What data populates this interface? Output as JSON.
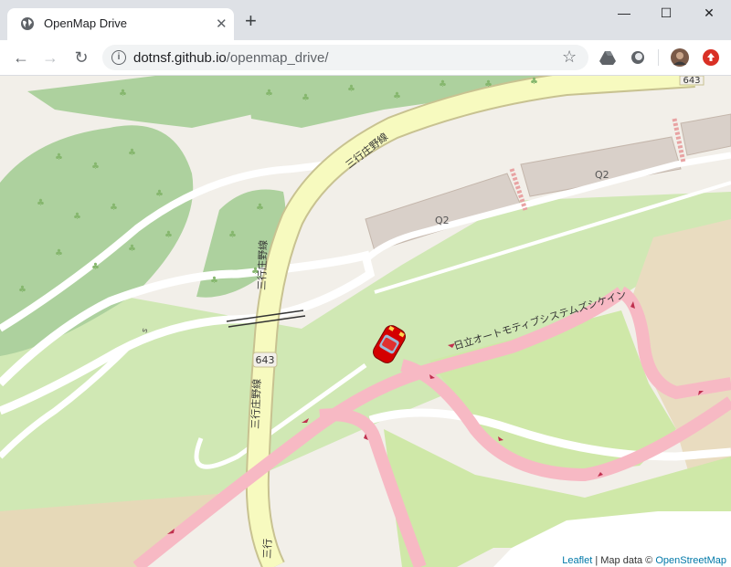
{
  "tab": {
    "title": "OpenMap Drive"
  },
  "window": {
    "minimize": "—",
    "maximize": "☐",
    "close": "✕"
  },
  "address": {
    "host": "dotnsf.github.io",
    "path": "/openmap_drive/"
  },
  "map": {
    "road_labels": {
      "route_name_a": "三行庄野線",
      "route_name_b": "三行庄野線",
      "route_name_c": "三行庄野線",
      "route_name_d": "三行",
      "route_number": "643",
      "route_number_top": "643",
      "building_a": "Q2",
      "building_b": "Q2",
      "track": "日立オートモティブシステムズシケイン"
    },
    "attribution": {
      "leaflet": "Leaflet",
      "sep": " | Map data © ",
      "osm": "OpenStreetMap"
    }
  }
}
